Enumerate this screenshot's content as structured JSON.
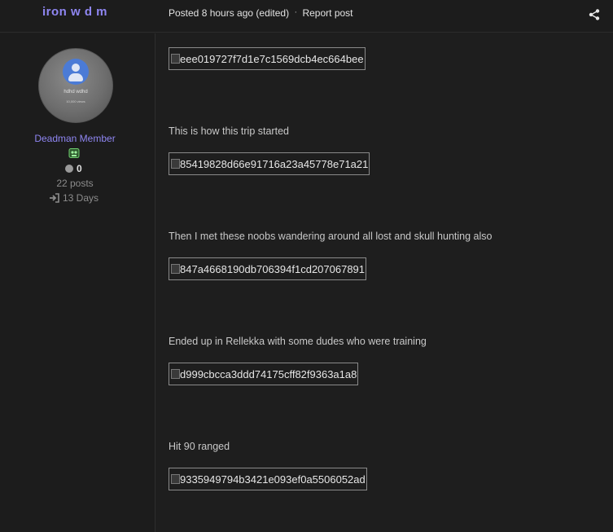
{
  "author": {
    "name": "iron w d m",
    "avatar_line1": "hdhd wdhd",
    "avatar_line2": "10,000 views",
    "group": "Deadman Member",
    "reputation": "0",
    "posts": "22 posts",
    "days": "13 Days"
  },
  "post": {
    "posted": "Posted 8 hours ago (edited)",
    "separator": "·",
    "report": "Report post",
    "share_icon": "share-icon",
    "images": [
      "eee019727f7d1e7c1569dcb4ec664bee",
      "85419828d66e91716a23a45778e71a21",
      "847a4668190db706394f1cd207067891",
      "d999cbcca3ddd74175cff82f9363a1a8",
      "9335949794b3421e093ef0a5506052ad"
    ],
    "captions": [
      "This is how this trip started",
      "Then I met these noobs wandering around all lost and skull hunting also",
      "Ended up in Rellekka with some dudes who were training",
      "Hit 90 ranged"
    ]
  }
}
